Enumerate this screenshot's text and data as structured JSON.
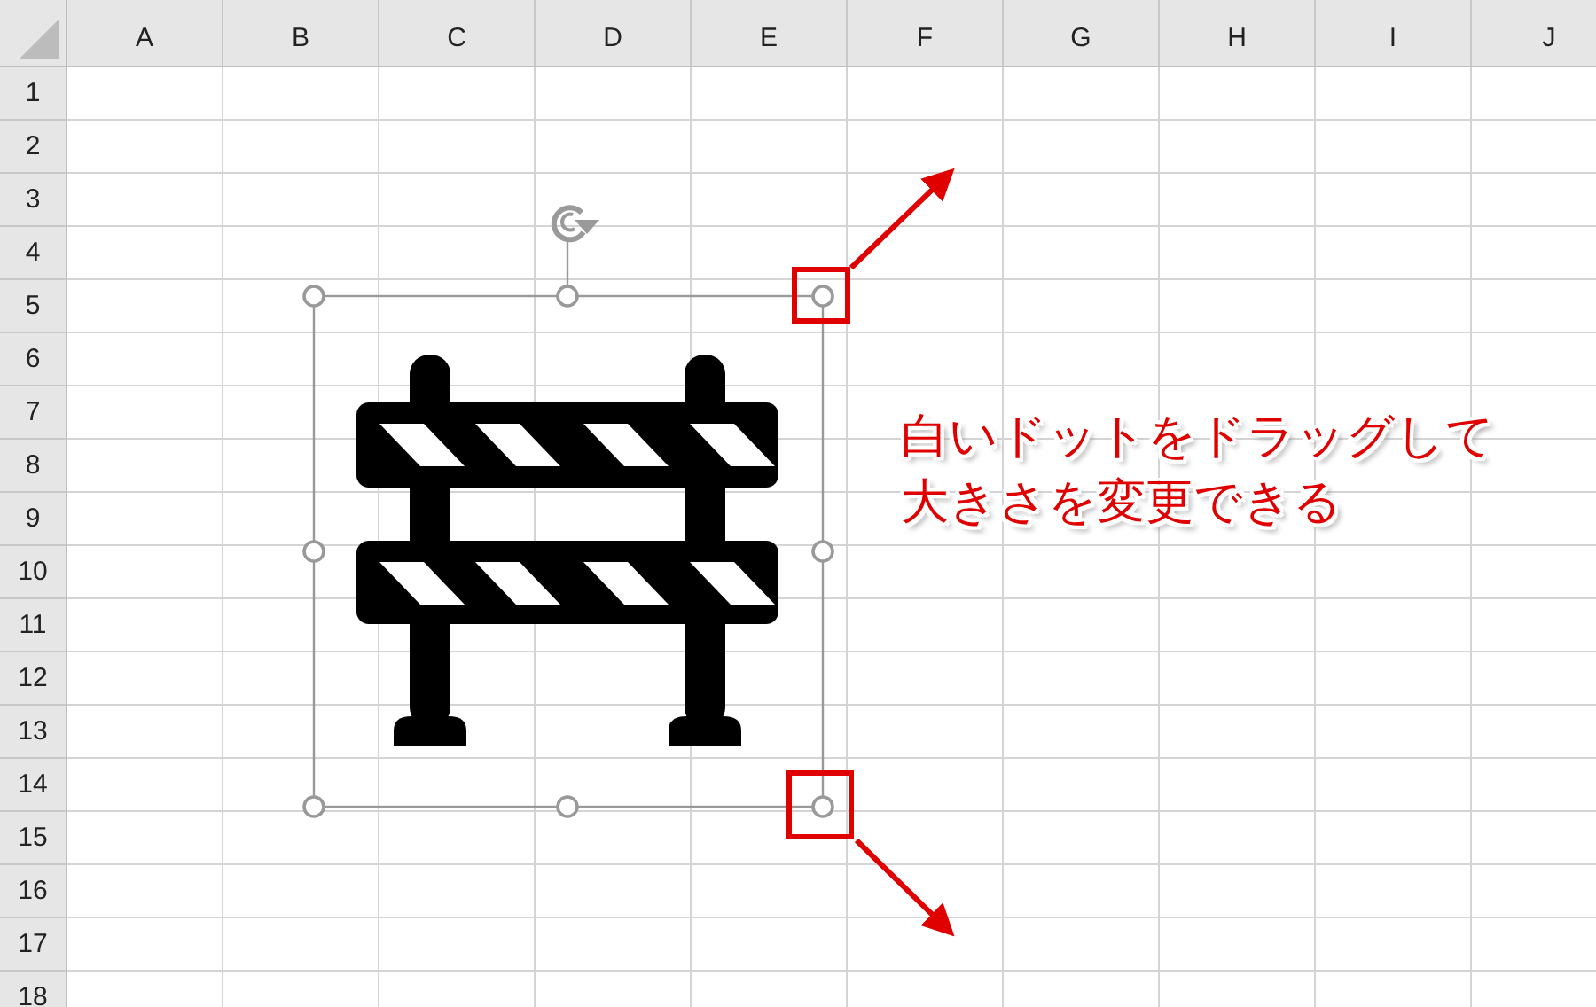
{
  "column_headers": [
    "A",
    "B",
    "C",
    "D",
    "E",
    "F",
    "G",
    "H",
    "I",
    "J"
  ],
  "row_headers": [
    "1",
    "2",
    "3",
    "4",
    "5",
    "6",
    "7",
    "8",
    "9",
    "10",
    "11",
    "12",
    "13",
    "14",
    "15",
    "16",
    "17",
    "18"
  ],
  "callout": {
    "text": "白いドットをドラッグして大きさを変更できる"
  }
}
